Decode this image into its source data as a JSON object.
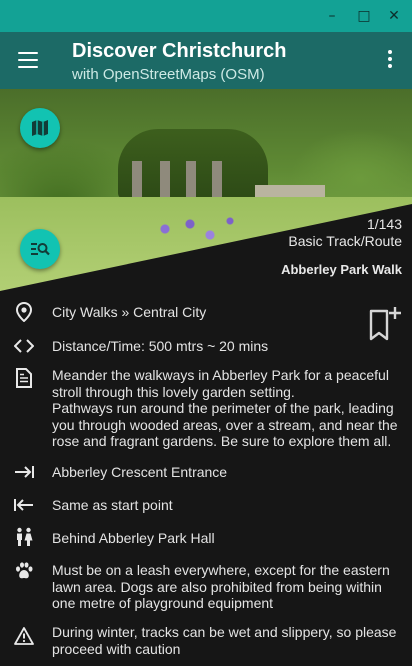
{
  "window": {
    "minimize_glyph": "–",
    "maximize_glyph": "□",
    "close_glyph": "✕"
  },
  "appbar": {
    "title": "Discover Christchurch",
    "subtitle": "with OpenStreetMaps (OSM)",
    "menu_icon": "hamburger-icon",
    "overflow_icon": "more-vert-icon"
  },
  "hero": {
    "count": "1/143",
    "type": "Basic Track/Route",
    "name": "Abberley Park Walk",
    "map_fab_icon": "map-icon",
    "search_fab_icon": "manage-search-icon",
    "accent": "#12c3b2"
  },
  "details": {
    "location": "City Walks » Central City",
    "distance": "Distance/Time: 500 mtrs ~ 20 mins",
    "description": [
      "Meander the walkways in Abberley Park for a peaceful stroll through this lovely garden setting.",
      "Pathways run around the perimeter of the park, leading you through wooded areas, over a stream, and near the rose and fragrant gardens. Be sure to explore them all."
    ],
    "start": "Abberley Crescent Entrance",
    "finish": "Same as start point",
    "toilets": "Behind Abberley Park Hall",
    "dogs": "Must be on a leash everywhere, except for the eastern lawn area. Dogs are also prohibited from being within one metre of playground equipment",
    "warning": "During winter, tracks can be wet and slippery, so please proceed with caution"
  },
  "colors": {
    "titlebar": "#13a295",
    "appbar": "#1c6a66",
    "background": "#161616"
  }
}
